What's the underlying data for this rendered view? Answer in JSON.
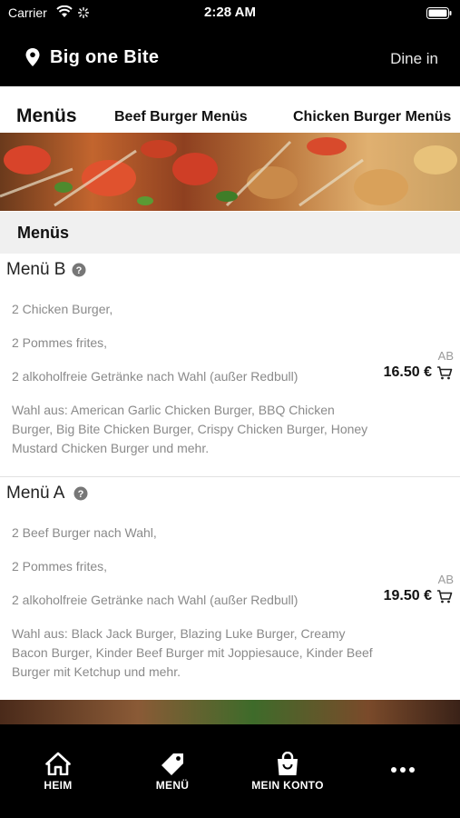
{
  "status_bar": {
    "carrier": "Carrier",
    "time": "2:28 AM"
  },
  "header": {
    "restaurant_name": "Big one Bite",
    "mode": "Dine in"
  },
  "tabs": [
    {
      "label": "Menüs",
      "active": true
    },
    {
      "label": "Beef Burger Menüs",
      "active": false
    },
    {
      "label": "Chicken Burger Menüs",
      "active": false
    }
  ],
  "section": {
    "title": "Menüs"
  },
  "items": [
    {
      "name": "Menü B",
      "lines": [
        " 2 Chicken Burger,",
        "2 Pommes frites,",
        "2 alkoholfreie Getränke nach Wahl (außer Redbull)"
      ],
      "choices": "Wahl aus: American Garlic Chicken Burger, BBQ Chicken Burger, Big Bite Chicken Burger, Crispy Chicken Burger, Honey Mustard Chicken Burger und mehr.",
      "price_prefix": "AB",
      "price": "16.50 €"
    },
    {
      "name": "Menü A",
      "lines": [
        "2 Beef Burger nach Wahl,",
        "2 Pommes frites,",
        "2 alkoholfreie Getränke nach Wahl (außer Redbull)"
      ],
      "choices": "Wahl aus: Black Jack Burger, Blazing Luke Burger, Creamy Bacon Burger, Kinder Beef Burger mit Joppiesauce, Kinder Beef Burger mit Ketchup und mehr.",
      "price_prefix": "AB",
      "price": "19.50 €"
    }
  ],
  "bottom_nav": [
    {
      "label": "HEIM",
      "icon": "home-icon"
    },
    {
      "label": "MENÜ",
      "icon": "tag-icon"
    },
    {
      "label": "MEIN KONTO",
      "icon": "shopping-bag-icon"
    },
    {
      "label": "",
      "icon": "more-icon"
    }
  ],
  "colors": {
    "bar_background": "#000000",
    "section_background": "#f0f0f0",
    "description_text": "#8a8a8a"
  }
}
